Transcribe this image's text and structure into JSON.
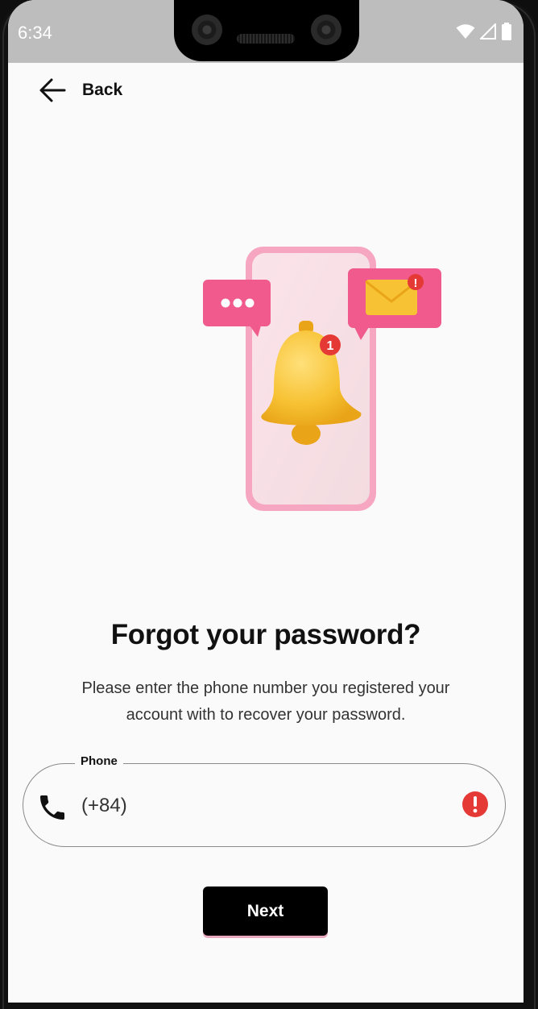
{
  "status_bar": {
    "time": "6:34",
    "icons": [
      "wifi-icon",
      "signal-icon",
      "battery-icon"
    ]
  },
  "header": {
    "back_label": "Back",
    "back_icon": "arrow-left-icon"
  },
  "illustration": {
    "description_icons": [
      "phone-icon",
      "chat-bubble-icon",
      "mail-icon",
      "bell-icon"
    ],
    "bell_badge": "1",
    "mail_badge": "!",
    "colors": {
      "phone": "#f6a6c1",
      "bubble": "#f05a8c",
      "bell": "#f7c234",
      "badge": "#e53935"
    }
  },
  "main": {
    "title": "Forgot your password?",
    "subtitle": "Please enter the phone number you registered your account with to recover your password."
  },
  "phone_field": {
    "label": "Phone",
    "value": "(+84)",
    "leading_icon": "phone-icon",
    "trailing_icon": "error-icon",
    "error_color": "#e53935"
  },
  "actions": {
    "next_label": "Next"
  }
}
